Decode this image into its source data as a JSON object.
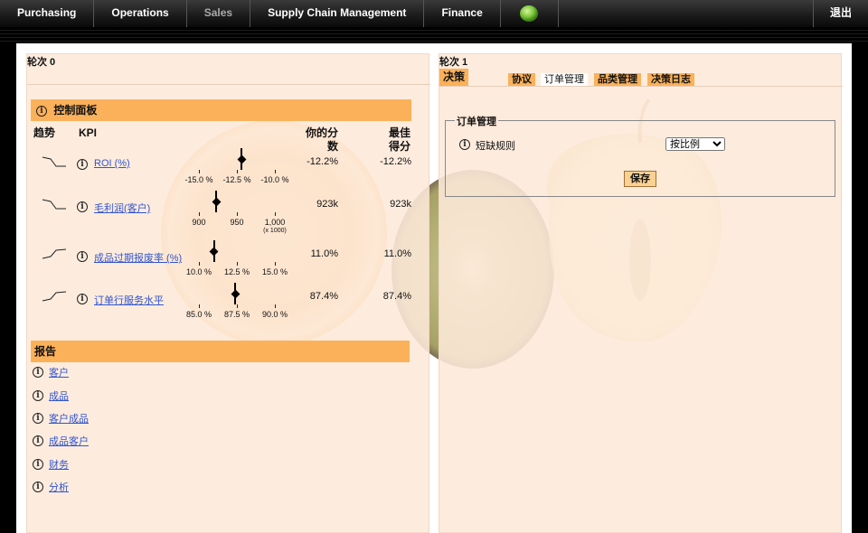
{
  "nav": {
    "items": [
      "Purchasing",
      "Operations",
      "Sales",
      "Supply Chain Management",
      "Finance"
    ],
    "logout": "退出"
  },
  "left": {
    "round_title": "轮次 0",
    "dashboard_title": "控制面板",
    "col_trend": "趋势",
    "col_kpi": "KPI",
    "col_score_1": "你的分",
    "col_score_2": "数",
    "col_best_1": "最佳",
    "col_best_2": "得分",
    "kpis": [
      {
        "name": "ROI (%)",
        "score": "-12.2%",
        "best": "-12.2%",
        "ticks": [
          "-15.0 %",
          "-12.5 %",
          "-10.0 %"
        ],
        "sub": "",
        "value": -12.2,
        "min": -15.0,
        "max": -10.0,
        "trend": "down"
      },
      {
        "name": "毛利润(客户)",
        "score": "923k",
        "best": "923k",
        "ticks": [
          "900",
          "950",
          "1,000"
        ],
        "sub": "(x 1000)",
        "value": 923,
        "min": 900,
        "max": 1000,
        "trend": "down"
      },
      {
        "name": "成品过期报废率 (%)",
        "score": "11.0%",
        "best": "11.0%",
        "ticks": [
          "10.0 %",
          "12.5 %",
          "15.0 %"
        ],
        "sub": "",
        "value": 11.0,
        "min": 10.0,
        "max": 15.0,
        "trend": "up"
      },
      {
        "name": "订单行服务水平",
        "score": "87.4%",
        "best": "87.4%",
        "ticks": [
          "85.0 %",
          "87.5 %",
          "90.0 %"
        ],
        "sub": "",
        "value": 87.4,
        "min": 85.0,
        "max": 90.0,
        "trend": "up"
      }
    ],
    "reports_title": "报告",
    "reports": [
      "客户",
      "成品",
      "客户成品",
      "成品客户",
      "财务",
      "分析"
    ]
  },
  "right": {
    "round_title": "轮次 1",
    "decision_tab": "决策",
    "tabs": [
      "协议",
      "订单管理",
      "品类管理",
      "决策日志"
    ],
    "active_tab": "订单管理",
    "fieldset_title": "订单管理",
    "shortage_label": "短缺规则",
    "shortage_value": "按比例",
    "save_label": "保存"
  },
  "colors": {
    "accent": "#fbb15a",
    "panel": "#fde9da",
    "link": "#3355cc"
  }
}
